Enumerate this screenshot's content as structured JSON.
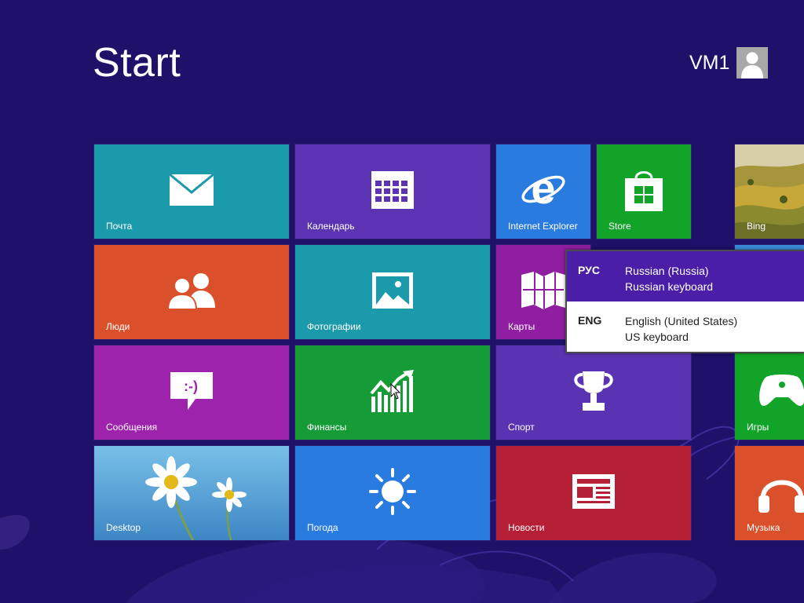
{
  "header": {
    "title": "Start",
    "user_name": "VM1",
    "avatar_icon": "user-silhouette-icon"
  },
  "tiles": {
    "mail": {
      "label": "Почта",
      "icon": "mail-icon",
      "color": "#1a9aaa"
    },
    "calendar": {
      "label": "Календарь",
      "icon": "calendar-icon",
      "color": "#5b33b3"
    },
    "ie": {
      "label": "Internet Explorer",
      "icon": "internet-explorer-icon",
      "color": "#2a7be0"
    },
    "store": {
      "label": "Store",
      "icon": "store-bag-icon",
      "color": "#12a329"
    },
    "bing": {
      "label": "Bing",
      "icon": "landscape-photo",
      "color": "#c59a2a"
    },
    "people": {
      "label": "Люди",
      "icon": "people-icon",
      "color": "#d9502b"
    },
    "photos": {
      "label": "Фотографии",
      "icon": "photo-icon",
      "color": "#1a9aaa"
    },
    "maps": {
      "label": "Карты",
      "icon": "map-icon",
      "color": "#8f1ea0"
    },
    "messaging": {
      "label": "Сообщения",
      "icon": "message-bubble-icon",
      "color": "#9d23ad"
    },
    "finance": {
      "label": "Финансы",
      "icon": "finance-chart-icon",
      "color": "#169c37"
    },
    "sports": {
      "label": "Спорт",
      "icon": "trophy-icon",
      "color": "#5a33b3"
    },
    "games": {
      "label": "Игры",
      "icon": "xbox-controller-icon",
      "color": "#12a329"
    },
    "desktop": {
      "label": "Desktop",
      "icon": "daisy-wallpaper",
      "color": "#5aa6d8"
    },
    "weather": {
      "label": "Погода",
      "icon": "sun-icon",
      "color": "#2a7be0"
    },
    "news": {
      "label": "Новости",
      "icon": "newspaper-icon",
      "color": "#b52037"
    },
    "music": {
      "label": "Музыка",
      "icon": "headphones-icon",
      "color": "#d9502b"
    }
  },
  "language_popup": {
    "items": [
      {
        "code": "РУС",
        "language": "Russian (Russia)",
        "keyboard": "Russian keyboard",
        "selected": true
      },
      {
        "code": "ENG",
        "language": "English (United States)",
        "keyboard": "US keyboard",
        "selected": false
      }
    ]
  },
  "colors": {
    "background": "#1f1069",
    "popup_selected": "#4a1ea6"
  }
}
